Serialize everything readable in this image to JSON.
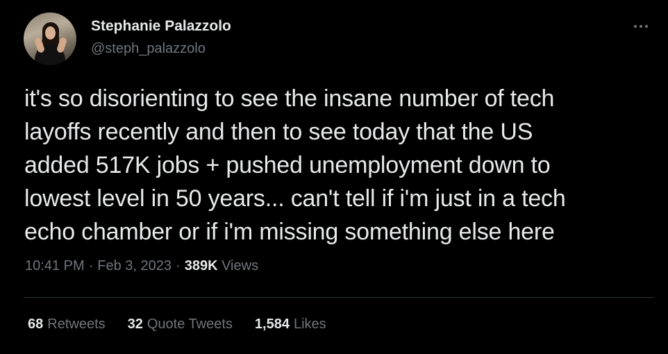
{
  "author": {
    "display_name": "Stephanie Palazzolo",
    "handle": "@steph_palazzolo"
  },
  "tweet": {
    "text": "it's so disorienting to see the insane number of tech\nlayoffs recently and then to see today that the US\nadded 517K jobs + pushed unemployment down to\nlowest level in 50 years... can't tell if i'm just in a tech\necho chamber or if i'm missing something else here"
  },
  "meta": {
    "time": "10:41 PM",
    "separator": "·",
    "date": "Feb 3, 2023",
    "views_count": "389K",
    "views_label": "Views"
  },
  "stats": {
    "retweets_count": "68",
    "retweets_label": "Retweets",
    "quotes_count": "32",
    "quotes_label": "Quote Tweets",
    "likes_count": "1,584",
    "likes_label": "Likes"
  },
  "icons": {
    "more": "more-horizontal-icon"
  },
  "colors": {
    "background": "#000000",
    "text_primary": "#e7e9ea",
    "text_secondary": "#71767b",
    "divider": "#2f3336"
  }
}
